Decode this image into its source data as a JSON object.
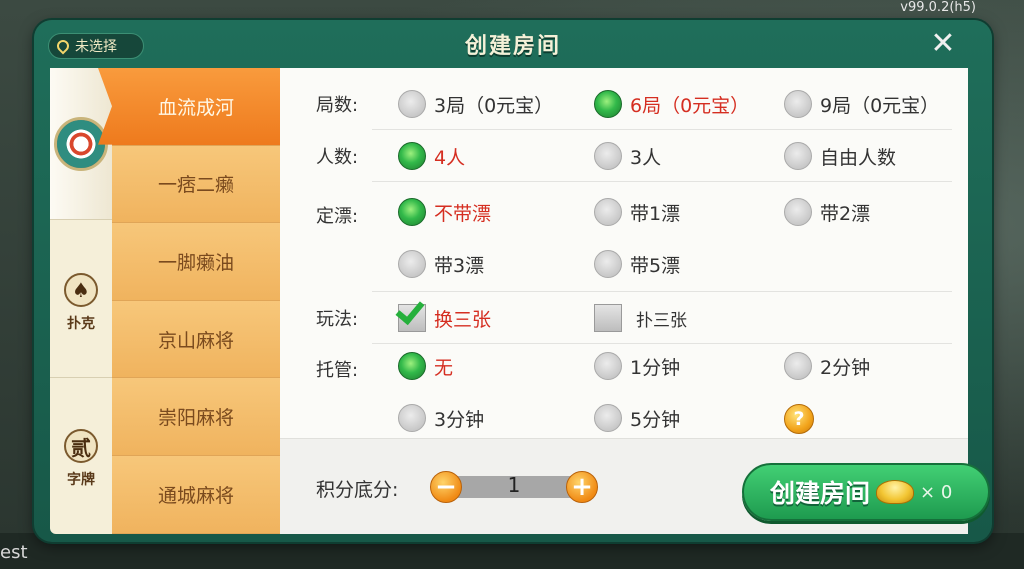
{
  "version": "v99.0.2(h5)",
  "background_bottom": {
    "left_text": "est"
  },
  "dialog": {
    "title": "创建房间",
    "location_label": "未选择",
    "close_label": "✕"
  },
  "categories": [
    {
      "label": ""
    },
    {
      "label": "扑克",
      "icon_glyph": "♠"
    },
    {
      "label": "字牌",
      "icon_glyph": "贰"
    }
  ],
  "games": [
    {
      "label": "血流成河"
    },
    {
      "label": "一痞二癞"
    },
    {
      "label": "一脚癞油"
    },
    {
      "label": "京山麻将"
    },
    {
      "label": "崇阳麻将"
    },
    {
      "label": "通城麻将"
    }
  ],
  "options": {
    "rounds": {
      "label": "局数:",
      "items": [
        {
          "text": "3局（0元宝）"
        },
        {
          "text": "6局（0元宝）"
        },
        {
          "text": "9局（0元宝）"
        }
      ]
    },
    "players": {
      "label": "人数:",
      "items": [
        {
          "text": "4人"
        },
        {
          "text": "3人"
        },
        {
          "text": "自由人数"
        }
      ]
    },
    "piao": {
      "label": "定漂:",
      "items": [
        {
          "text": "不带漂"
        },
        {
          "text": "带1漂"
        },
        {
          "text": "带2漂"
        },
        {
          "text": "带3漂"
        },
        {
          "text": "带5漂"
        }
      ]
    },
    "play": {
      "label": "玩法:",
      "items": [
        {
          "text": "换三张"
        },
        {
          "text": "扑三张"
        }
      ]
    },
    "hosting": {
      "label": "托管:",
      "items": [
        {
          "text": "无"
        },
        {
          "text": "1分钟"
        },
        {
          "text": "2分钟"
        },
        {
          "text": "3分钟"
        },
        {
          "text": "5分钟"
        }
      ],
      "help_glyph": "?"
    }
  },
  "footer": {
    "score_label": "积分底分:",
    "score_value": "1",
    "minus_glyph": "−",
    "plus_glyph": "+",
    "create_label": "创建房间",
    "cost": "× 0"
  },
  "colors": {
    "selected_text": "#d52e21",
    "accent_orange": "#ee7a1d",
    "dialog_green": "#1f6e5a",
    "button_green": "#1e9b4f"
  }
}
